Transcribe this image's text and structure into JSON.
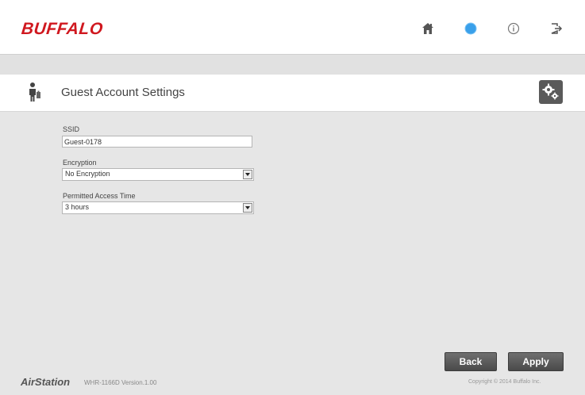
{
  "header": {
    "logo_text": "BUFFALO",
    "icons": [
      {
        "name": "home-icon"
      },
      {
        "name": "language-icon"
      },
      {
        "name": "info-icon"
      },
      {
        "name": "logout-icon"
      }
    ]
  },
  "page": {
    "title": "Guest Account Settings",
    "title_icon": "guest-person-icon",
    "settings_icon": "gears-icon"
  },
  "form": {
    "ssid_label": "SSID",
    "ssid_value": "Guest-0178",
    "encryption_label": "Encryption",
    "encryption_value": "No Encryption",
    "access_time_label": "Permitted Access Time",
    "access_time_value": "3 hours"
  },
  "buttons": {
    "back": "Back",
    "apply": "Apply"
  },
  "footer": {
    "brand": "AirStation",
    "model_version": "WHR-1166D Version.1.00",
    "copyright": "Copyright © 2014 Buffalo Inc."
  },
  "colors": {
    "brand_red": "#d0181f",
    "language_blue": "#3aa0ea",
    "button_dark": "#555555"
  }
}
